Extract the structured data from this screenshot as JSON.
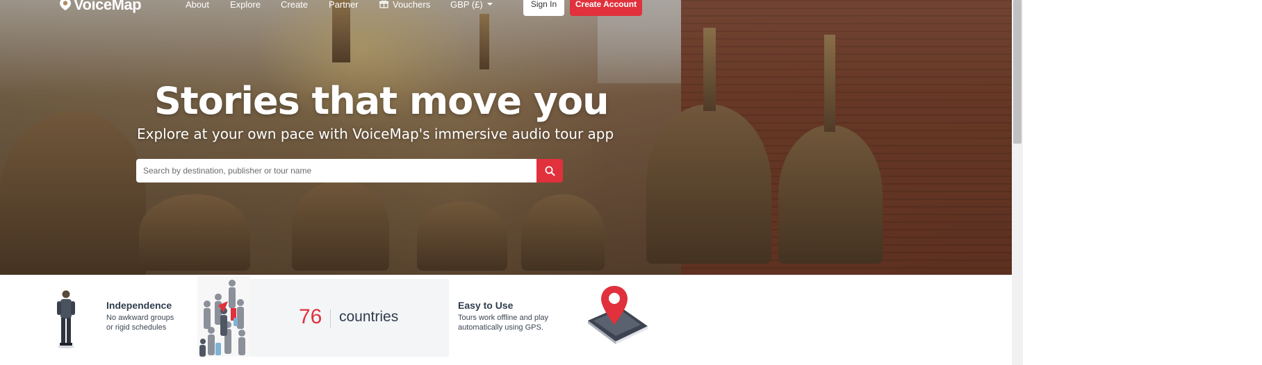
{
  "nav": {
    "logo": "VoiceMap",
    "links": [
      "About",
      "Explore",
      "Create",
      "Partner"
    ],
    "vouchers": "Vouchers",
    "currency": "GBP (£)",
    "sign_in": "Sign In",
    "create_account": "Create Account"
  },
  "hero": {
    "headline": "Stories that move you",
    "subheadline": "Explore at your own pace with VoiceMap's immersive audio tour app"
  },
  "search": {
    "placeholder": "Search by destination, publisher or tour name"
  },
  "features": {
    "independence": {
      "title": "Independence",
      "description": "No awkward groups\nor rigid schedules"
    },
    "countries": {
      "count": "76",
      "label": "countries"
    },
    "easy": {
      "title": "Easy to Use",
      "description": "Tours work offline and play\nautomatically using GPS."
    }
  },
  "colors": {
    "accent": "#e0313c",
    "heading": "#2f3b4c"
  }
}
